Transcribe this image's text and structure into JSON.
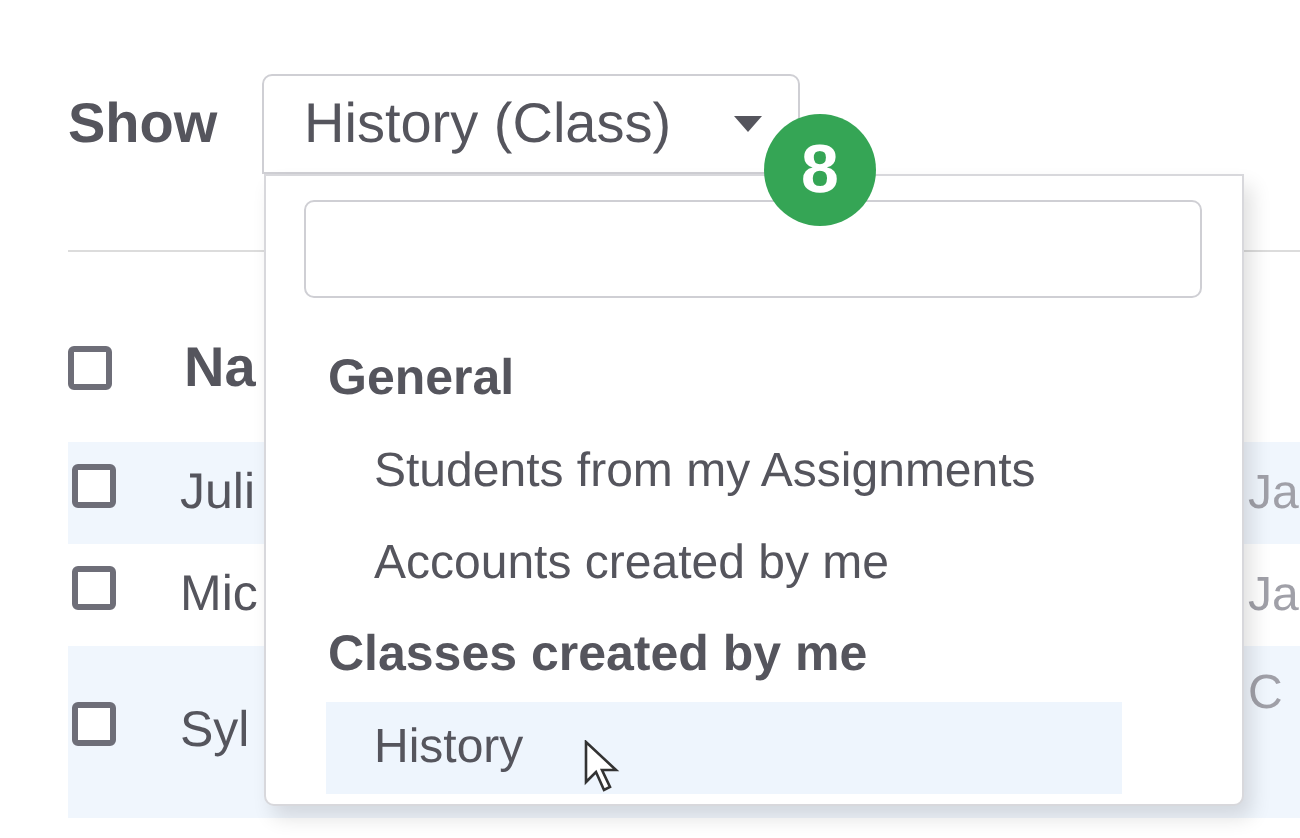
{
  "filter": {
    "label": "Show",
    "value": "History (Class)",
    "badge": "8"
  },
  "dropdown": {
    "groups": [
      {
        "heading": "General",
        "items": [
          {
            "label": "Students from my Assignments",
            "selected": false
          },
          {
            "label": "Accounts created by me",
            "selected": false
          }
        ]
      },
      {
        "heading": "Classes created by me",
        "items": [
          {
            "label": "History",
            "selected": true
          }
        ]
      }
    ]
  },
  "table": {
    "header": {
      "checked": false,
      "column_1": "Na"
    },
    "rows": [
      {
        "checked": false,
        "column_1": "Juli",
        "column_2": "Ja"
      },
      {
        "checked": false,
        "column_1": "Mic",
        "column_2": "Ja"
      },
      {
        "checked": false,
        "column_1": "Syl",
        "column_2": "C"
      }
    ]
  }
}
